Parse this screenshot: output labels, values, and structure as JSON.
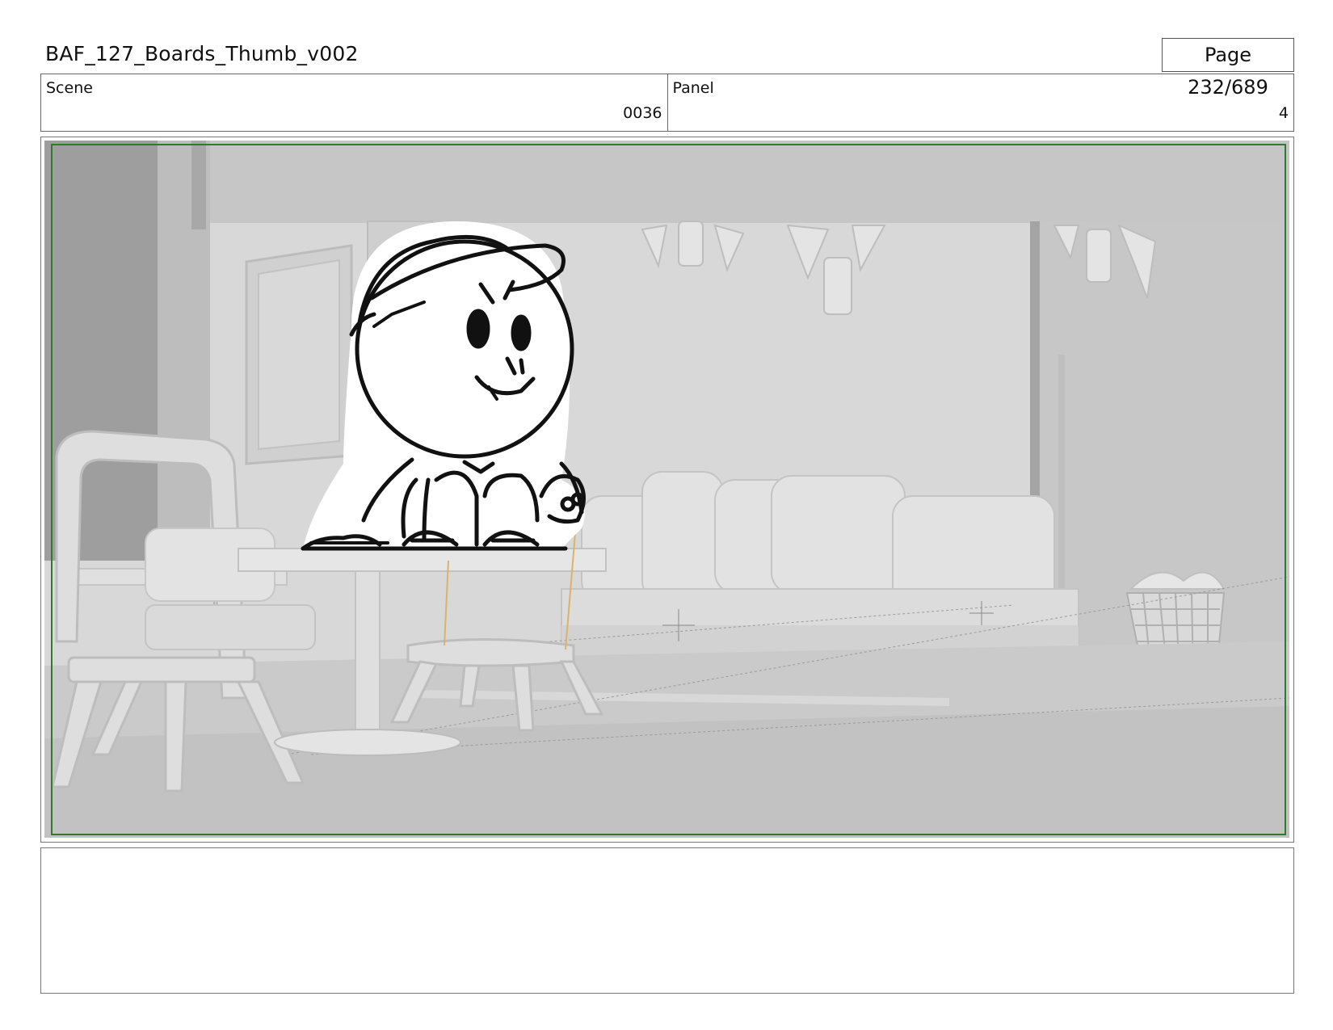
{
  "document": {
    "title": "BAF_127_Boards_Thumb_v002",
    "page": "Page 232/689"
  },
  "info": {
    "scene_label": "Scene",
    "scene_value": "0036",
    "panel_label": "Panel",
    "panel_value": "4"
  },
  "frame": {
    "safe_frame_color": "#2f7a2f",
    "description_icon": "storyboard-panel-image"
  },
  "notes": {
    "text": ""
  }
}
